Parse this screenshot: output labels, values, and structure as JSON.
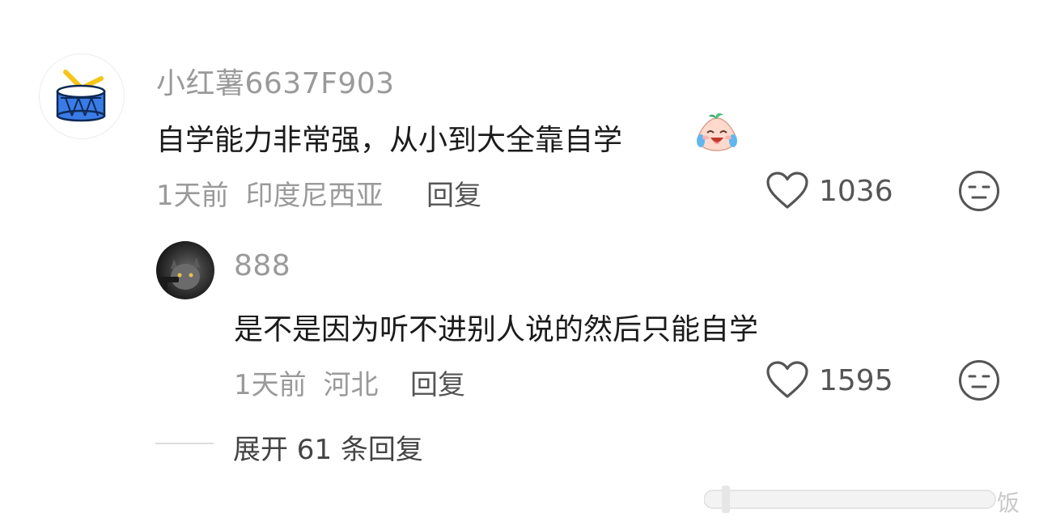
{
  "comment": {
    "username": "小红薯6637F903",
    "text": "自学能力非常强，从小到大全靠自学",
    "time": "1天前",
    "location": "印度尼西亚",
    "reply_label": "回复",
    "likes": "1036",
    "emoji_icon": "crying-laughing-peach-emoji-icon",
    "avatar_icon": "drum-icon"
  },
  "reply": {
    "username": "888",
    "text": "是不是因为听不进别人说的然后只能自学",
    "time": "1天前",
    "location": "河北",
    "reply_label": "回复",
    "likes": "1595",
    "avatar_icon": "cat-avatar"
  },
  "expand": {
    "label": "展开 61 条回复"
  },
  "watermark": {
    "text": "饭"
  },
  "colors": {
    "muted": "#9a9a9a",
    "text": "#1b1b1b",
    "drum_blue": "#3a7be6",
    "drum_yellow": "#f5c518"
  }
}
